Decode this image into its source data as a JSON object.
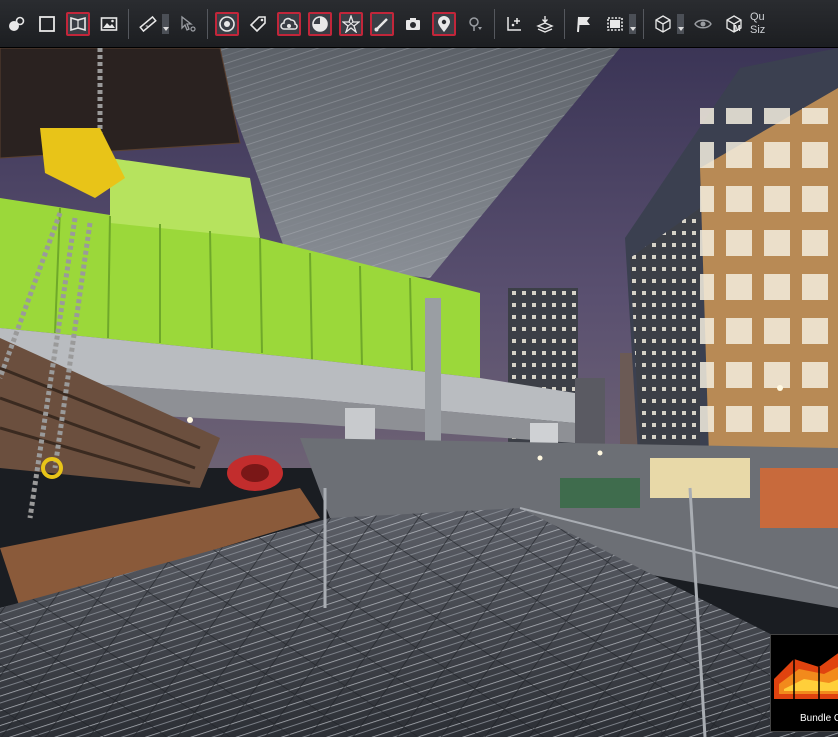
{
  "toolbar": {
    "groups": [
      [
        "target-dots-icon",
        "square-icon",
        "panorama-icon",
        "image-icon"
      ],
      [
        "ruler-icon",
        "cursor-point-icon"
      ],
      [
        "circle-target-icon",
        "tag-icon",
        "cloud-icon",
        "half-circle-icon",
        "star-mesh-icon",
        "brush-icon",
        "camera-icon",
        "location-pin-icon",
        "pin-down-icon"
      ],
      [
        "add-point-icon",
        "layer-stack-icon"
      ],
      [
        "flag-icon",
        "select-box-icon"
      ],
      [
        "cube-view-icon",
        "eye-off-icon",
        "cube-m-icon"
      ]
    ],
    "active": [
      "panorama-icon",
      "circle-target-icon",
      "cloud-icon",
      "half-circle-icon",
      "star-mesh-icon",
      "brush-icon",
      "location-pin-icon"
    ],
    "truncated_line1": "Qu",
    "truncated_line2": "Siz"
  },
  "thumbnail": {
    "label": "Bundle C"
  },
  "colors": {
    "active_border": "#c2263a",
    "toolbar_bg": "#222428",
    "sky": "#4c4466",
    "green_panel": "#9bd83a"
  }
}
